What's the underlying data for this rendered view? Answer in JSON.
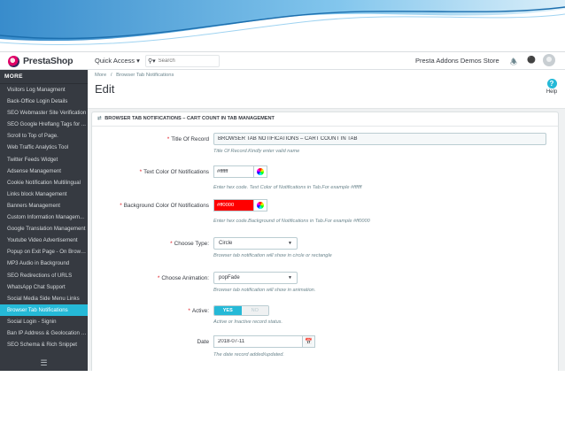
{
  "topbar": {
    "logo_text": "PrestaShop",
    "quick_access": "Quick Access ▾",
    "search_placeholder": "Search",
    "store_name": "Presta Addons Demos Store"
  },
  "sidebar": {
    "heading": "MORE",
    "items": [
      "Visitors Log Managment",
      "Back-Office Login Details",
      "SEO Webmaster Site Verification",
      "SEO Google Hreflang Tags for ...",
      "Scroll to Top of Page.",
      "Web Traffic Analytics Tool",
      "Twitter Feeds Widget",
      "Adsense Management",
      "Cookie Notification Multilingual",
      "Links block Management",
      "Banners Management",
      "Custom Information Managem...",
      "Google Translation Management",
      "Youtube Video Advertisement",
      "Popup on Exit Page - On Brows...",
      "MP3 Audio in Background",
      "SEO Redirections of URLS",
      "WhatsApp Chat Support",
      "Social Media Side Menu Links",
      "Browser Tab Notifications",
      "Social Login - Signin",
      "Ban IP Address & Geolocation R...",
      "SEO Schema & Rich Snippet"
    ],
    "active_index": 19
  },
  "header": {
    "breadcrumb": [
      "More",
      "/",
      "Browser Tab Notifications"
    ],
    "title": "Edit",
    "help_label": "Help"
  },
  "panel": {
    "heading": "BROWSER TAB NOTIFICATIONS – CART COUNT IN TAB MANAGEMENT",
    "fields": {
      "title": {
        "label": "Title Of Record",
        "value": "BROWSER TAB NOTIFICATIONS – CART COUNT IN TAB",
        "help": "Title Of Record.Kindly enter valid name"
      },
      "text_color": {
        "label": "Text Color Of Notifications",
        "value": "#ffffff",
        "help": "Enter hex code. Text Color of Notifications in Tab.For example #ffffff"
      },
      "bg_color": {
        "label": "Background Color Of Notifications",
        "value": "#ff0000",
        "help": "Enter hex code.Background of Notifications in Tab.For example #ff0000"
      },
      "type": {
        "label": "Choose Type:",
        "value": "Circle",
        "help": "Browser tab notification will show in circle or rectangle"
      },
      "animation": {
        "label": "Choose Animation:",
        "value": "popFade",
        "help": "Browser tab notification will show in animation."
      },
      "active": {
        "label": "Active:",
        "yes": "YES",
        "no": "NO",
        "help": "Active or Inactive record status."
      },
      "date": {
        "label": "Date",
        "value": "2018-07-11",
        "help": "The date record added/updated."
      }
    }
  },
  "colors": {
    "accent": "#25b9d7",
    "sidebar_bg": "#363a41",
    "required": "#e0161f",
    "bg_swatch": "#ff0000"
  }
}
